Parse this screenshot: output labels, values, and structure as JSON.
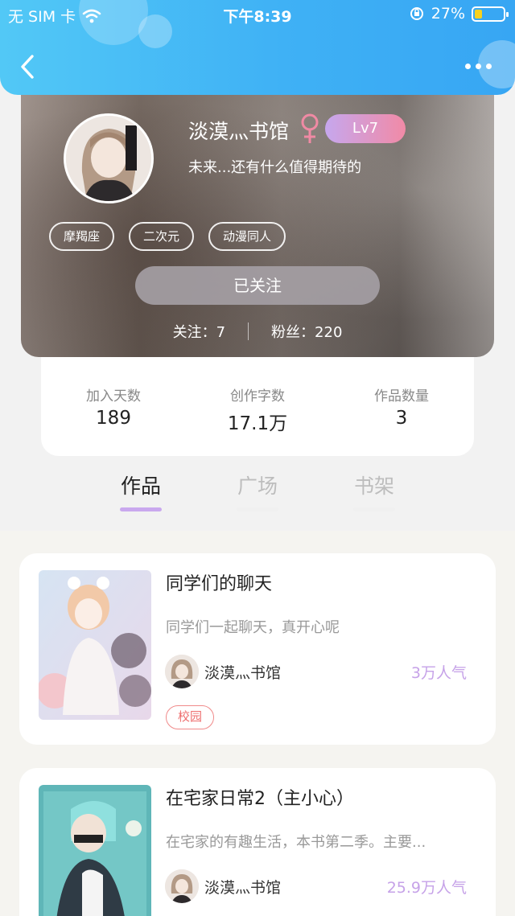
{
  "status_bar": {
    "carrier": "无 SIM 卡",
    "time": "下午8:39",
    "battery": "27%",
    "battery_level": 0.27
  },
  "profile": {
    "name": "淡漠灬书馆",
    "level": "Lv7",
    "bio": "未来...还有什么值得期待的",
    "tags": [
      "摩羯座",
      "二次元",
      "动漫同人"
    ],
    "follow_button": "已关注",
    "following_label": "关注：7",
    "fans_label": "粉丝：220"
  },
  "stats": [
    {
      "label": "加入天数",
      "value": "189"
    },
    {
      "label": "创作字数",
      "value": "17.1万"
    },
    {
      "label": "作品数量",
      "value": "3"
    }
  ],
  "tabs": [
    {
      "label": "作品",
      "active": true
    },
    {
      "label": "广场",
      "active": false
    },
    {
      "label": "书架",
      "active": false
    }
  ],
  "books": [
    {
      "title": "同学们的聊天",
      "desc": "同学们一起聊天，真开心呢",
      "author": "淡漠灬书馆",
      "popularity": "3万人气",
      "tag": "校园"
    },
    {
      "title": "在宅家日常2（主小心）",
      "desc": "在宅家的有趣生活，本书第二季。主要...",
      "author": "淡漠灬书馆",
      "popularity": "25.9万人气",
      "tag": ""
    }
  ],
  "colors": {
    "header": "#3fb1f5",
    "accent": "#c9a8ee",
    "tag_red": "#ee6e6e"
  }
}
